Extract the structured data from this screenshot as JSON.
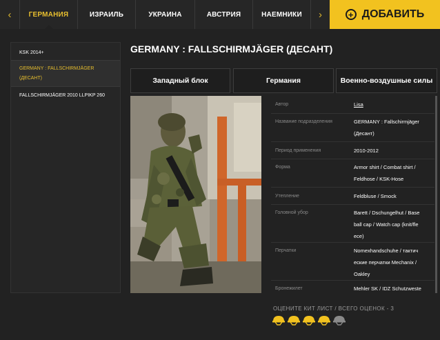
{
  "nav": {
    "tabs": [
      {
        "label": "ГЕРМАНИЯ",
        "active": true
      },
      {
        "label": "ИЗРАИЛЬ",
        "active": false
      },
      {
        "label": "УКРАИНА",
        "active": false
      },
      {
        "label": "АВСТРИЯ",
        "active": false
      },
      {
        "label": "НАЕМНИКИ",
        "active": false
      }
    ],
    "add_label": "ДОБАВИТЬ",
    "prev_arrow": "‹",
    "next_arrow": "›"
  },
  "sidebar": {
    "items": [
      {
        "label": "KSK 2014+",
        "active": false
      },
      {
        "label": "GERMANY : FALLSCHIRMJÄGER (ДЕСАНТ)",
        "active": true
      },
      {
        "label": "FALLSCHIRMJÄGER 2010 LLPIKP 260",
        "active": false
      }
    ]
  },
  "main": {
    "title": "GERMANY : FALLSCHIRMJÄGER (ДЕСАНТ)",
    "tabs": [
      "Западный блок",
      "Германия",
      "Военно-воздушные силы"
    ],
    "info_rows": [
      {
        "label": "Автор",
        "value": "Lisa",
        "link": true
      },
      {
        "label": "Название подразделения",
        "value": "GERMANY : Fallschirmjäger (Десант)"
      },
      {
        "label": "Период применения",
        "value": "2010-2012"
      },
      {
        "label": "Форма",
        "value": "Armor shirt / Combat shirt / Feldhose / KSK-Hose"
      },
      {
        "label": "Утепление",
        "value": "Feldbluse / Smock"
      },
      {
        "label": "Головной убор",
        "value": "Barett / Dschungelhut / Base ball cap / Watch cap (knit/fle ece)"
      },
      {
        "label": "Перчатки",
        "value": "Nomexhandschuhe / тактич еские перчатки Mechanix / Oakley"
      },
      {
        "label": "Бронежилет",
        "value": "Mehler SK / IDZ Schutzweste"
      }
    ],
    "rating_text": "ОЦЕНИТЕ КИТ ЛИСТ / ВСЕГО ОЦЕНОК - 3",
    "rating": {
      "filled": 4,
      "max": 5
    }
  },
  "colors": {
    "accent": "#f2c21f",
    "active_text": "#e8bf2f",
    "background": "#222222"
  }
}
